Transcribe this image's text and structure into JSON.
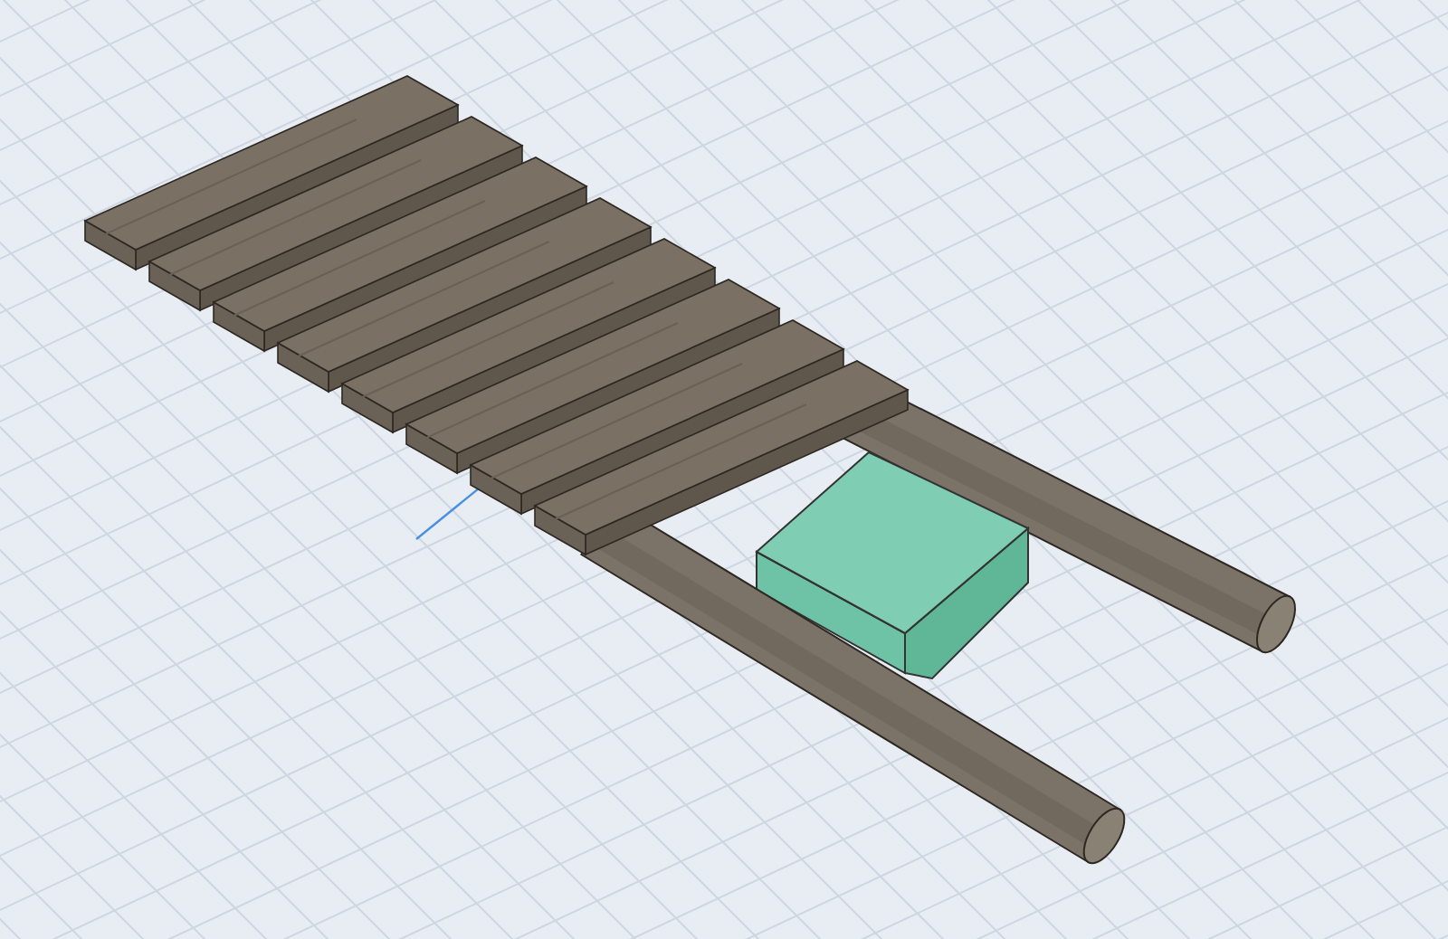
{
  "viewport": {
    "objects": [
      {
        "kind": "log",
        "selected": false
      },
      {
        "kind": "box",
        "selected": true
      },
      {
        "kind": "log",
        "selected": false
      },
      {
        "kind": "plank",
        "selected": false
      },
      {
        "kind": "plank",
        "selected": false
      },
      {
        "kind": "plank",
        "selected": false
      },
      {
        "kind": "plank",
        "selected": false
      },
      {
        "kind": "plank",
        "selected": false
      },
      {
        "kind": "plank",
        "selected": false
      },
      {
        "kind": "plank",
        "selected": false
      },
      {
        "kind": "plank",
        "selected": false
      }
    ]
  }
}
